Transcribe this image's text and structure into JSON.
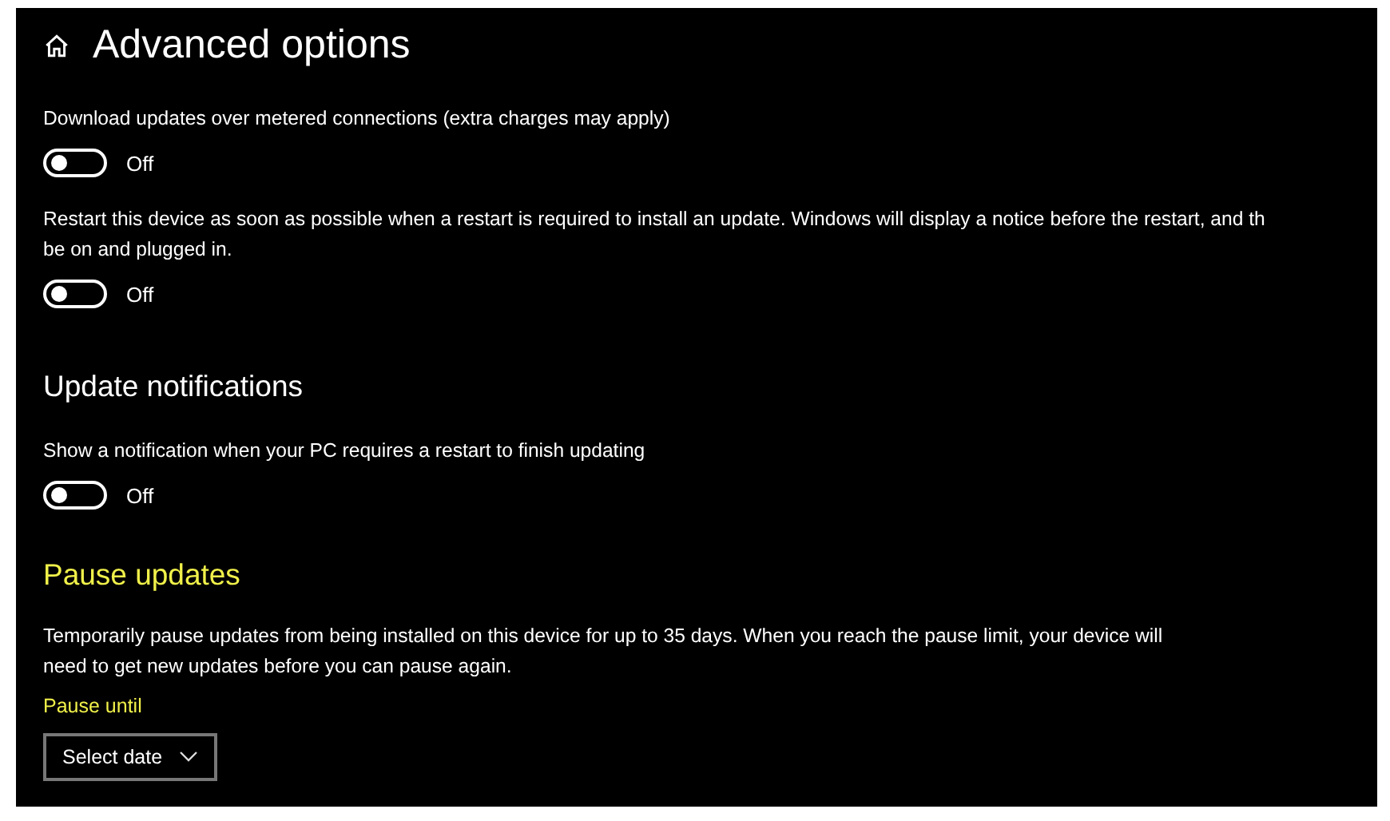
{
  "page": {
    "title": "Advanced options"
  },
  "sections": [
    {
      "items": [
        {
          "kind": "toggle",
          "label": "Download updates over metered connections (extra charges may apply)",
          "on": false,
          "state": "Off"
        },
        {
          "kind": "toggle",
          "label": "Restart this device as soon as possible when a restart is required to install an update. Windows will display a notice before the restart, and th\nbe on and plugged in.",
          "on": false,
          "state": "Off"
        }
      ]
    },
    {
      "heading": "Update notifications",
      "accent": false,
      "items": [
        {
          "kind": "toggle",
          "label": "Show a notification when your PC requires a restart to finish updating",
          "on": false,
          "state": "Off"
        }
      ]
    },
    {
      "heading": "Pause updates",
      "accent": true,
      "items": [
        {
          "kind": "text",
          "label": "Temporarily pause updates from being installed on this device for up to 35 days. When you reach the pause limit, your device will\nneed to get new updates before you can pause again."
        },
        {
          "kind": "dropdown",
          "label": "Pause until",
          "value": "Select date"
        }
      ]
    }
  ]
}
